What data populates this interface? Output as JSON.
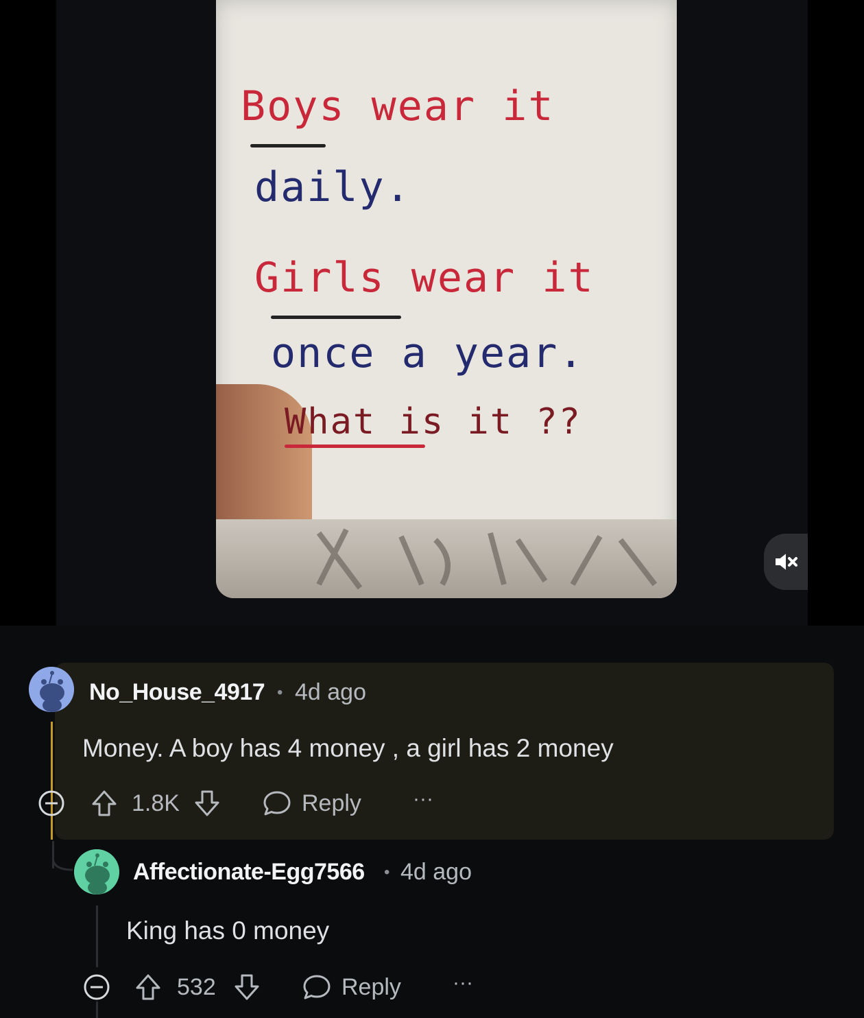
{
  "media": {
    "card_lines": [
      "Boys wear it",
      "daily.",
      "Girls wear it",
      "once a year.",
      "What is it ??"
    ],
    "mute_icon": "speaker-muted-icon"
  },
  "comments": [
    {
      "username": "No_House_4917",
      "separator": "•",
      "time": "4d ago",
      "body": "Money. A boy has 4 money , a girl has 2 money",
      "votes": "1.8K",
      "reply_label": "Reply",
      "more_label": "···"
    },
    {
      "username": "Affectionate-Egg7566",
      "separator": "•",
      "time": "4d ago",
      "body": "King has 0 money",
      "votes": "532",
      "reply_label": "Reply",
      "more_label": "···"
    }
  ],
  "colors": {
    "highlight_bg": "#1d1c15",
    "thread_gold": "#c49a25",
    "avatar1": "#8fa8e8",
    "avatar2": "#5fd1a3"
  }
}
